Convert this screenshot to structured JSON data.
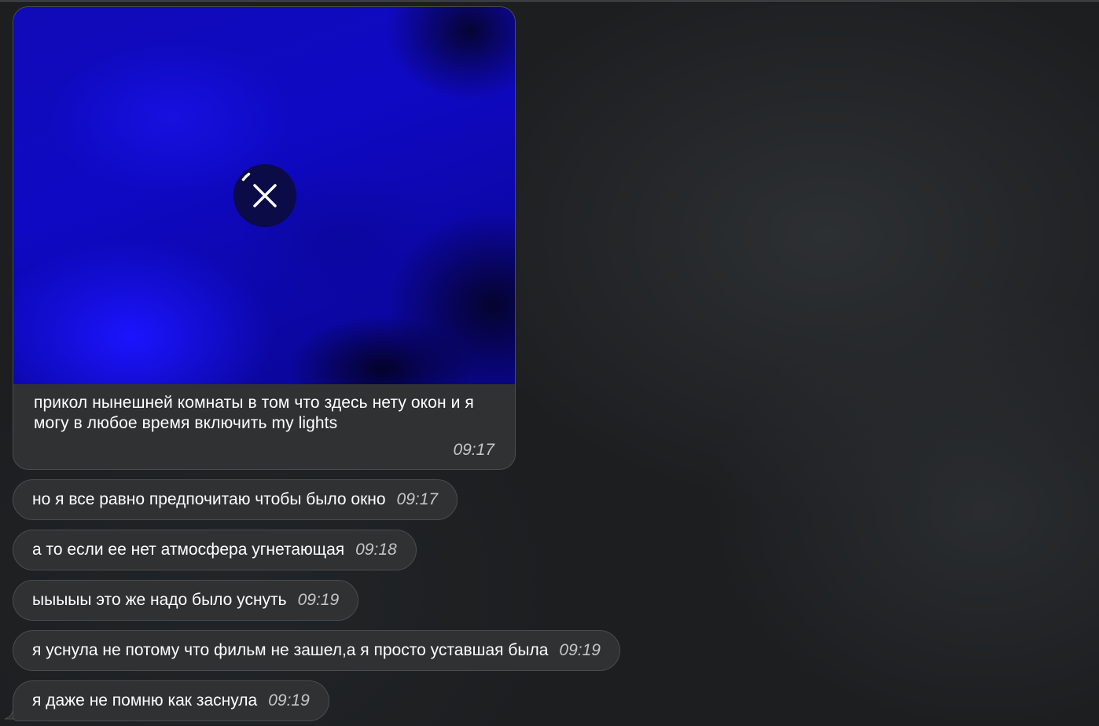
{
  "media_message": {
    "caption": "прикол нынешней комнаты в том что здесь нету окон и я могу в любое время включить my lights",
    "time": "09:17",
    "image_colors": [
      "#100ab8",
      "#1b14ff",
      "#05032e"
    ],
    "download_progress": 0.05,
    "cancel_icon": "close-icon"
  },
  "messages": [
    {
      "text": "но я все равно предпочитаю чтобы было окно",
      "time": "09:17"
    },
    {
      "text": "а то если ее нет атмосфера угнетающая",
      "time": "09:18"
    },
    {
      "text": "ыыыыы это же надо было уснуть",
      "time": "09:19"
    },
    {
      "text": "я уснула не потому что фильм не зашел,а я просто уставшая была",
      "time": "09:19"
    },
    {
      "text": "я даже не помню как заснула",
      "time": "09:19"
    }
  ],
  "colors": {
    "bubble": "#2f3133",
    "bubble_border": "#4a4c4e",
    "time_text": "#c4c6c8",
    "background": "#1c1e20"
  }
}
